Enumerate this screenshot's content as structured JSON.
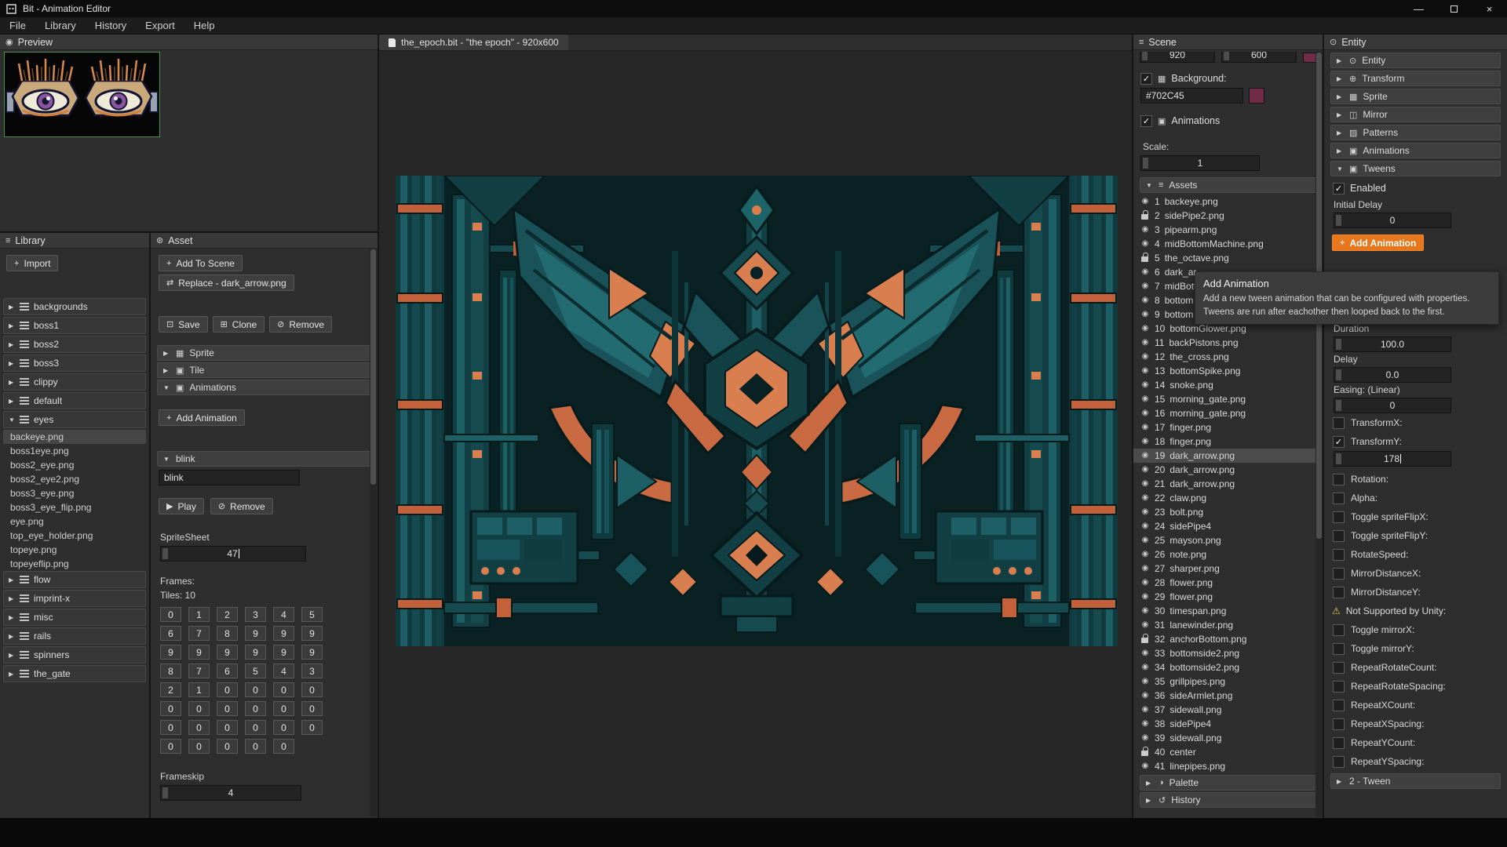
{
  "window": {
    "title": "Bit - Animation Editor",
    "minimize": "—",
    "close": "×"
  },
  "menu": {
    "items": [
      "File",
      "Library",
      "History",
      "Export",
      "Help"
    ]
  },
  "preview": {
    "title": "Preview"
  },
  "library": {
    "title": "Library",
    "import_glyph": "+",
    "import_label": "Import",
    "tree": [
      {
        "type": "folder",
        "arrow": "▶",
        "label": "backgrounds"
      },
      {
        "type": "folder",
        "arrow": "▶",
        "label": "boss1"
      },
      {
        "type": "folder",
        "arrow": "▶",
        "label": "boss2"
      },
      {
        "type": "folder",
        "arrow": "▶",
        "label": "boss3"
      },
      {
        "type": "folder",
        "arrow": "▶",
        "label": "clippy"
      },
      {
        "type": "folder",
        "arrow": "▶",
        "label": "default"
      },
      {
        "type": "folder",
        "arrow": "▼",
        "label": "eyes"
      },
      {
        "type": "file",
        "label": "backeye.png",
        "selected": true
      },
      {
        "type": "file",
        "label": "boss1eye.png"
      },
      {
        "type": "file",
        "label": "boss2_eye.png"
      },
      {
        "type": "file",
        "label": "boss2_eye2.png"
      },
      {
        "type": "file",
        "label": "boss3_eye.png"
      },
      {
        "type": "file",
        "label": "boss3_eye_flip.png"
      },
      {
        "type": "file",
        "label": "eye.png"
      },
      {
        "type": "file",
        "label": "top_eye_holder.png"
      },
      {
        "type": "file",
        "label": "topeye.png"
      },
      {
        "type": "file",
        "label": "topeyeflip.png"
      },
      {
        "type": "folder",
        "arrow": "▶",
        "label": "flow"
      },
      {
        "type": "folder",
        "arrow": "▶",
        "label": "imprint-x"
      },
      {
        "type": "folder",
        "arrow": "▶",
        "label": "misc"
      },
      {
        "type": "folder",
        "arrow": "▶",
        "label": "rails"
      },
      {
        "type": "folder",
        "arrow": "▶",
        "label": "spinners"
      },
      {
        "type": "folder",
        "arrow": "▶",
        "label": "the_gate"
      }
    ]
  },
  "asset": {
    "title": "Asset",
    "add_to_scene": {
      "glyph": "+",
      "label": "Add To Scene"
    },
    "replace": {
      "glyph": "⇄",
      "label": "Replace  - dark_arrow.png"
    },
    "tools": [
      {
        "glyph": "⊡",
        "label": "Save"
      },
      {
        "glyph": "⊞",
        "label": "Clone"
      },
      {
        "glyph": "⊘",
        "label": "Remove"
      }
    ],
    "section_bars": [
      {
        "arrow": "▶",
        "glyph": "▦",
        "label": "Sprite"
      },
      {
        "arrow": "▶",
        "glyph": "▣",
        "label": "Tile"
      },
      {
        "arrow": "▼",
        "glyph": "▣",
        "label": "Animations"
      }
    ],
    "add_animation": {
      "glyph": "+",
      "label": "Add Animation"
    },
    "anim_bar": {
      "arrow": "▼",
      "label": "blink"
    },
    "anim_name_value": "blink",
    "play": {
      "glyph": "▶",
      "label": "Play"
    },
    "remove": {
      "glyph": "⊘",
      "label": "Remove"
    },
    "spritesheet_label": "SpriteSheet",
    "spritesheet_value": "47",
    "frames_label": "Frames:",
    "tiles_label": "Tiles: 10",
    "frames": [
      0,
      1,
      2,
      3,
      4,
      5,
      6,
      7,
      8,
      9,
      9,
      9,
      9,
      9,
      9,
      9,
      9,
      9,
      8,
      7,
      6,
      5,
      4,
      3,
      2,
      1,
      0,
      0,
      0,
      0,
      0,
      0,
      0,
      0,
      0,
      0,
      0,
      0,
      0,
      0,
      0,
      0,
      0,
      0,
      0,
      0,
      0
    ],
    "frameskip_label": "Frameskip",
    "frameskip_value": "4"
  },
  "canvas": {
    "tab_label": "the_epoch.bit - \"the epoch\" - 920x600"
  },
  "scene": {
    "title": "Scene",
    "clipped_width": "920",
    "clipped_height": "600",
    "background_label": "Background:",
    "background_color_value": "#702C45",
    "animations_label": "Animations",
    "scale_label": "Scale:",
    "scale_value": "1",
    "assets_bar": {
      "arrow": "▼",
      "glyph": "≡",
      "label": "Assets"
    },
    "assets": [
      {
        "n": "1",
        "name": "backeye.png",
        "icon": "eye"
      },
      {
        "n": "2",
        "name": "sidePipe2.png",
        "icon": "lock"
      },
      {
        "n": "3",
        "name": "pipearm.png",
        "icon": "eye"
      },
      {
        "n": "4",
        "name": "midBottomMachine.png",
        "icon": "eye"
      },
      {
        "n": "5",
        "name": "the_octave.png",
        "icon": "lock"
      },
      {
        "n": "6",
        "name": "dark_ar",
        "icon": "eye"
      },
      {
        "n": "7",
        "name": "midBott",
        "icon": "eye"
      },
      {
        "n": "8",
        "name": "bottom",
        "icon": "eye"
      },
      {
        "n": "9",
        "name": "bottom",
        "icon": "eye"
      },
      {
        "n": "10",
        "name": "bottomGlower.png",
        "icon": "eye"
      },
      {
        "n": "11",
        "name": "backPistons.png",
        "icon": "eye"
      },
      {
        "n": "12",
        "name": "the_cross.png",
        "icon": "eye"
      },
      {
        "n": "13",
        "name": "bottomSpike.png",
        "icon": "eye"
      },
      {
        "n": "14",
        "name": "snoke.png",
        "icon": "eye"
      },
      {
        "n": "15",
        "name": "morning_gate.png",
        "icon": "eye"
      },
      {
        "n": "16",
        "name": "morning_gate.png",
        "icon": "eye"
      },
      {
        "n": "17",
        "name": "finger.png",
        "icon": "eye"
      },
      {
        "n": "18",
        "name": "finger.png",
        "icon": "eye"
      },
      {
        "n": "19",
        "name": "dark_arrow.png",
        "icon": "eye",
        "selected": true
      },
      {
        "n": "20",
        "name": "dark_arrow.png",
        "icon": "eye"
      },
      {
        "n": "21",
        "name": "dark_arrow.png",
        "icon": "eye"
      },
      {
        "n": "22",
        "name": "claw.png",
        "icon": "eye"
      },
      {
        "n": "23",
        "name": "bolt.png",
        "icon": "eye"
      },
      {
        "n": "24",
        "name": "sidePipe4",
        "icon": "eye"
      },
      {
        "n": "25",
        "name": "mayson.png",
        "icon": "eye"
      },
      {
        "n": "26",
        "name": "note.png",
        "icon": "eye"
      },
      {
        "n": "27",
        "name": "sharper.png",
        "icon": "eye"
      },
      {
        "n": "28",
        "name": "flower.png",
        "icon": "eye"
      },
      {
        "n": "29",
        "name": "flower.png",
        "icon": "eye"
      },
      {
        "n": "30",
        "name": "timespan.png",
        "icon": "eye"
      },
      {
        "n": "31",
        "name": "lanewinder.png",
        "icon": "eye"
      },
      {
        "n": "32",
        "name": "anchorBottom.png",
        "icon": "lock"
      },
      {
        "n": "33",
        "name": "bottomside2.png",
        "icon": "eye"
      },
      {
        "n": "34",
        "name": "bottomside2.png",
        "icon": "eye"
      },
      {
        "n": "35",
        "name": "grillpipes.png",
        "icon": "eye"
      },
      {
        "n": "36",
        "name": "sideArmlet.png",
        "icon": "eye"
      },
      {
        "n": "37",
        "name": "sidewall.png",
        "icon": "eye"
      },
      {
        "n": "38",
        "name": "sidePipe4",
        "icon": "eye"
      },
      {
        "n": "39",
        "name": "sidewall.png",
        "icon": "eye"
      },
      {
        "n": "40",
        "name": "center",
        "icon": "lock"
      },
      {
        "n": "41",
        "name": "linepipes.png",
        "icon": "eye"
      }
    ],
    "bottom_bars": [
      {
        "arrow": "▶",
        "glyph": "◑",
        "label": "Palette"
      },
      {
        "arrow": "▶",
        "glyph": "↺",
        "label": "History"
      }
    ]
  },
  "entity": {
    "title": "Entity",
    "sections": [
      {
        "arrow": "▶",
        "glyph": "⊙",
        "label": "Entity"
      },
      {
        "arrow": "▶",
        "glyph": "⊕",
        "label": "Transform"
      },
      {
        "arrow": "▶",
        "glyph": "▦",
        "label": "Sprite"
      },
      {
        "arrow": "▶",
        "glyph": "◫",
        "label": "Mirror"
      },
      {
        "arrow": "▶",
        "glyph": "▨",
        "label": "Patterns"
      },
      {
        "arrow": "▶",
        "glyph": "▣",
        "label": "Animations"
      }
    ],
    "tweens_bar": {
      "arrow": "▼",
      "glyph": "▣",
      "label": "Tweens"
    },
    "enabled_label": "Enabled",
    "initial_delay_label": "Initial Delay",
    "initial_delay_value": "0",
    "add_animation_glyph": "+",
    "add_animation_label": "Add Animation",
    "duration_label": "Duration",
    "duration_value": "100.0",
    "delay_label": "Delay",
    "delay_value": "0.0",
    "easing_label": "Easing: (Linear)",
    "easing_value": "0",
    "props": [
      {
        "label": "TransformX:"
      },
      {
        "label": "TransformY:",
        "checked": true,
        "value": "178"
      },
      {
        "label": "Rotation:"
      },
      {
        "label": "Alpha:"
      },
      {
        "label": "Toggle spriteFlipX:"
      },
      {
        "label": "Toggle spriteFlipY:"
      },
      {
        "label": "RotateSpeed:"
      },
      {
        "label": "MirrorDistanceX:"
      },
      {
        "label": "MirrorDistanceY:"
      }
    ],
    "warning_glyph": "⚠",
    "not_supported_label": "Not Supported by Unity:",
    "props_unsupported": [
      {
        "label": "Toggle mirrorX:"
      },
      {
        "label": "Toggle mirrorY:"
      },
      {
        "label": "RepeatRotateCount:"
      },
      {
        "label": "RepeatRotateSpacing:"
      },
      {
        "label": "RepeatXCount:"
      },
      {
        "label": "RepeatXSpacing:"
      },
      {
        "label": "RepeatYCount:"
      },
      {
        "label": "RepeatYSpacing:"
      }
    ],
    "tween2_bar": {
      "arrow": "▶",
      "label": "2 - Tween"
    }
  },
  "tooltip": {
    "title": "Add Animation",
    "line1": "Add a new tween animation that can be configured with properties.",
    "line2": "Tweens are run after eachother then looped back to the first."
  },
  "colors": {
    "accent_orange": "#E8771C",
    "background_swatch": "#702C45",
    "art_teal": "#1B5E63",
    "art_orange": "#D57A4A"
  }
}
